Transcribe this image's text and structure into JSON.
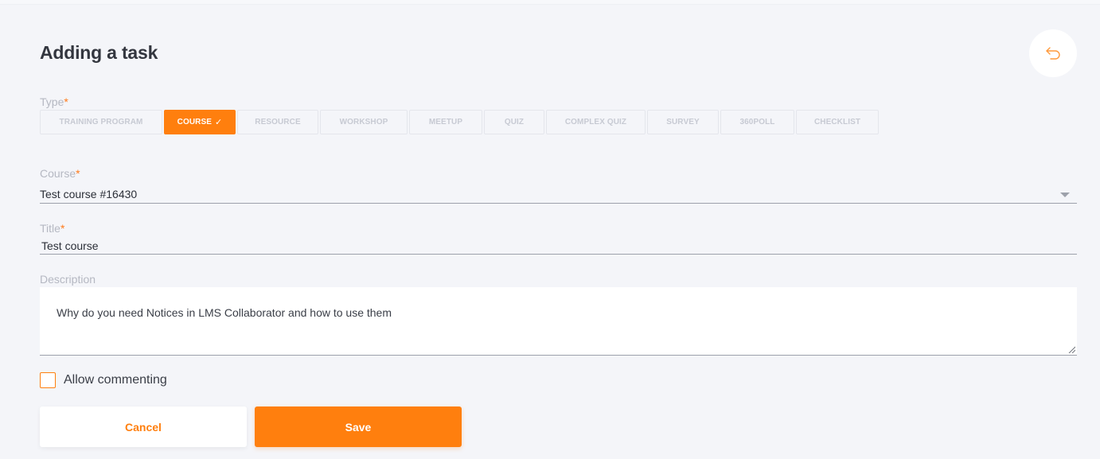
{
  "page": {
    "title": "Adding a task",
    "back_icon": "undo-arrow-icon"
  },
  "type_field": {
    "label": "Type",
    "required_mark": "*",
    "options": [
      {
        "label": "TRAINING PROGRAM",
        "selected": false
      },
      {
        "label": "COURSE",
        "selected": true
      },
      {
        "label": "RESOURCE",
        "selected": false
      },
      {
        "label": "WORKSHOP",
        "selected": false
      },
      {
        "label": "MEETUP",
        "selected": false
      },
      {
        "label": "QUIZ",
        "selected": false
      },
      {
        "label": "COMPLEX QUIZ",
        "selected": false
      },
      {
        "label": "SURVEY",
        "selected": false
      },
      {
        "label": "360POLL",
        "selected": false
      },
      {
        "label": "CHECKLIST",
        "selected": false
      }
    ],
    "selected_check": "✓"
  },
  "course_field": {
    "label": "Course",
    "required_mark": "*",
    "value": "Test course #16430"
  },
  "title_field": {
    "label": "Title",
    "required_mark": "*",
    "value": "Test course"
  },
  "description_field": {
    "label": "Description",
    "value": "Why do you need Notices in LMS Collaborator and how to use them"
  },
  "allow_commenting": {
    "label": "Allow commenting",
    "checked": false
  },
  "actions": {
    "cancel_label": "Cancel",
    "save_label": "Save"
  },
  "colors": {
    "accent": "#ff7f0e",
    "background": "#f4f5f9",
    "label_gray": "#b5b8c2"
  }
}
